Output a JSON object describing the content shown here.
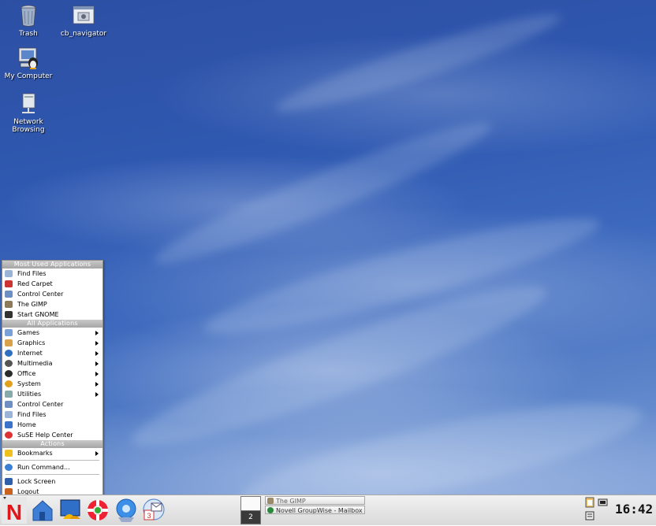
{
  "desktop": {
    "icons": [
      {
        "label": "Trash",
        "icon": "trash-icon"
      },
      {
        "label": "cb_navigator",
        "icon": "window-icon"
      },
      {
        "label": "My Computer",
        "icon": "computer-icon"
      },
      {
        "label": "Network Browsing",
        "icon": "network-icon"
      }
    ]
  },
  "menu": {
    "headers": {
      "most_used": "Most Used Applications",
      "all_apps": "All Applications",
      "actions": "Actions"
    },
    "most_used": [
      {
        "label": "Find Files",
        "icon": "find-icon"
      },
      {
        "label": "Red Carpet",
        "icon": "redcarpet-icon"
      },
      {
        "label": "Control Center",
        "icon": "control-icon"
      },
      {
        "label": "The GIMP",
        "icon": "gimp-icon"
      },
      {
        "label": "Start GNOME",
        "icon": "gnome-icon"
      }
    ],
    "all_apps": [
      {
        "label": "Games",
        "icon": "games-icon"
      },
      {
        "label": "Graphics",
        "icon": "graphics-icon"
      },
      {
        "label": "Internet",
        "icon": "internet-icon"
      },
      {
        "label": "Multimedia",
        "icon": "multimedia-icon"
      },
      {
        "label": "Office",
        "icon": "office-icon"
      },
      {
        "label": "System",
        "icon": "system-icon"
      },
      {
        "label": "Utilities",
        "icon": "utilities-icon"
      },
      {
        "label": "Control Center",
        "icon": "control-icon"
      },
      {
        "label": "Find Files",
        "icon": "find-icon"
      },
      {
        "label": "Home",
        "icon": "home-icon"
      },
      {
        "label": "SuSE Help Center",
        "icon": "help-icon"
      }
    ],
    "actions": [
      {
        "label": "Bookmarks",
        "icon": "bookmarks-icon"
      },
      {
        "label": "Run Command...",
        "icon": "run-icon"
      },
      {
        "label": "Lock Screen",
        "icon": "lock-icon"
      },
      {
        "label": "Logout",
        "icon": "logout-icon"
      }
    ]
  },
  "taskbar": {
    "launchers": [
      {
        "name": "start-button",
        "icon": "novell-n-icon"
      },
      {
        "name": "home-launcher",
        "icon": "home-icon"
      },
      {
        "name": "desktop-launcher",
        "icon": "show-desktop-icon"
      },
      {
        "name": "help-launcher",
        "icon": "lifebuoy-icon"
      },
      {
        "name": "browser-launcher",
        "icon": "konqueror-icon"
      },
      {
        "name": "mail-launcher",
        "icon": "mail-icon"
      }
    ],
    "pager": {
      "desktop2": "2"
    },
    "tasks": [
      {
        "label": "The GIMP",
        "icon": "gimp-icon"
      },
      {
        "label": "Novell GroupWise - Mailbox",
        "icon": "groupwise-icon"
      }
    ],
    "clock": "16:42"
  }
}
